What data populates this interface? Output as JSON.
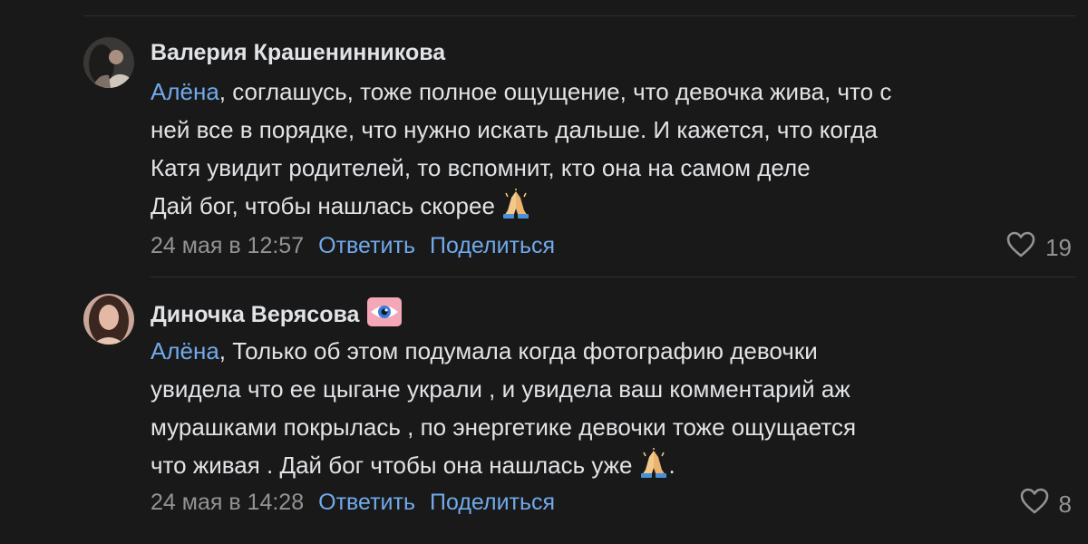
{
  "comments": [
    {
      "author": "Валерия Крашенинникова",
      "mention": "Алёна",
      "line1_rest": ", соглашусь, тоже полное ощущение, что девочка жива, что с",
      "line2": "ней все в порядке, что нужно искать дальше. И кажется, что когда",
      "line3": "Катя увидит родителей, то вспомнит, кто она на самом деле",
      "line4": "Дай бог, чтобы нашлась скорее",
      "date": "24 мая в 12:57",
      "reply_label": "Ответить",
      "share_label": "Поделиться",
      "likes": "19",
      "icons": [
        "avatar-photo",
        "folded-hands-emoji",
        "heart-icon"
      ]
    },
    {
      "author": "Диночка Верясова",
      "mention": "Алёна",
      "line1_rest": ", Только об этом подумала когда фотографию девочки",
      "line2": "увидела что ее цыгане украли , и увидела ваш комментарий аж",
      "line3": "мурашками покрылась , по энергетике девочки тоже ощущается",
      "line4": "что живая . Дай бог чтобы она нашлась уже",
      "line4_tail": ".",
      "date": "24 мая в 14:28",
      "reply_label": "Ответить",
      "share_label": "Поделиться",
      "likes": "8",
      "icons": [
        "avatar-photo",
        "eye-emoji",
        "folded-hands-emoji",
        "heart-icon"
      ]
    }
  ],
  "colors": {
    "background": "#191919",
    "text": "#e1e3e6",
    "link": "#71aaeb",
    "muted": "#939393"
  }
}
